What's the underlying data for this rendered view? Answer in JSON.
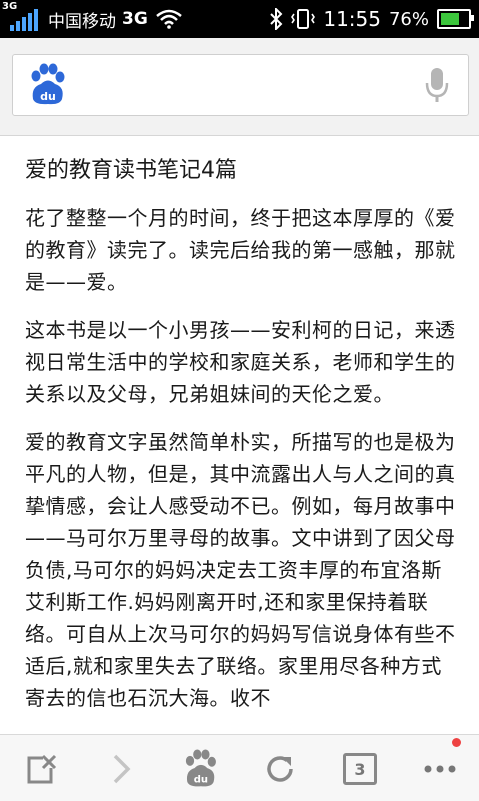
{
  "status_bar": {
    "network_small": "3G",
    "carrier": "中国移动",
    "network": "3G",
    "time": "11:55",
    "battery_percent": "76%",
    "battery_level": 0.76,
    "battery_color": "#3cc63c",
    "signal_color": "#4da6ff"
  },
  "search": {
    "logo_text": "du",
    "value": "",
    "placeholder": ""
  },
  "article": {
    "title": "爱的教育读书笔记4篇",
    "paragraphs": [
      "花了整整一个月的时间，终于把这本厚厚的《爱的教育》读完了。读完后给我的第一感触，那就是——爱。",
      "这本书是以一个小男孩——安利柯的日记，来透视日常生活中的学校和家庭关系，老师和学生的关系以及父母，兄弟姐妹间的天伦之爱。",
      "爱的教育文字虽然简单朴实，所描写的也是极为平凡的人物，但是，其中流露出人与人之间的真挚情感，会让人感受动不已。例如，每月故事中——马可尔万里寻母的故事。文中讲到了因父母负债,马可尔的妈妈决定去工资丰厚的布宜洛斯艾利斯工作.妈妈刚离开时,还和家里保持着联络。可自从上次马可尔的妈妈写信说身体有些不适后,就和家里失去了联络。家里用尽各种方式寄去的信也石沉大海。收不"
    ]
  },
  "toolbar": {
    "close_icon": "close-tab-icon",
    "forward_icon": "forward-arrow-icon",
    "home_logo_text": "du",
    "refresh_icon": "refresh-icon",
    "tab_count": "3",
    "menu_icon": "more-icon",
    "badge_color": "#ee4242"
  }
}
